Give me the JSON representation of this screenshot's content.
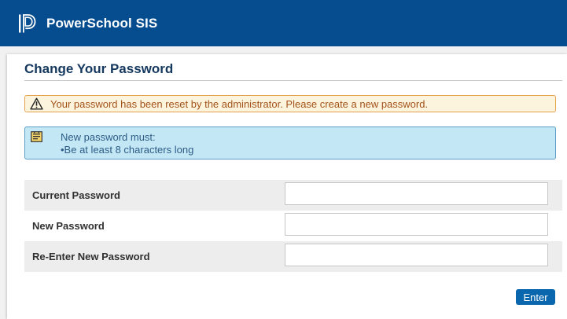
{
  "header": {
    "brand": "PowerSchool SIS",
    "background_color": "#064d8f",
    "logo_icon": "powerschool-logo-icon"
  },
  "page": {
    "title": "Change Your Password"
  },
  "warning": {
    "icon": "warning-triangle-icon",
    "text": "Your password has been reset by the administrator. Please create a new password.",
    "text_color": "#a3521a",
    "border_color": "#e5a14e",
    "background": "#fdf4dd"
  },
  "info": {
    "icon": "note-icon",
    "heading": "New password must:",
    "rules": [
      "•Be at least 8 characters long"
    ],
    "background": "#c4e7f5",
    "border_color": "#5b9dc4"
  },
  "form": {
    "fields": [
      {
        "label": "Current Password",
        "value": "",
        "placeholder": ""
      },
      {
        "label": "New Password",
        "value": "",
        "placeholder": ""
      },
      {
        "label": "Re-Enter New Password",
        "value": "",
        "placeholder": ""
      }
    ],
    "submit_label": "Enter",
    "submit_color": "#0a67ad"
  }
}
